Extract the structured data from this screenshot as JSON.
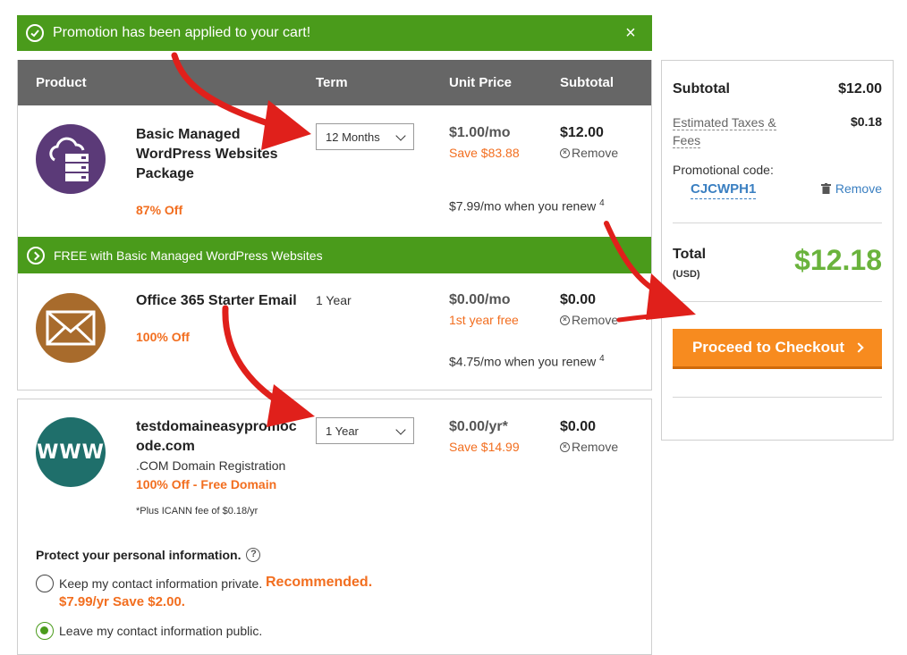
{
  "promo_banner": {
    "text": "Promotion has been applied to your cart!",
    "close": "×"
  },
  "cart_header": {
    "product": "Product",
    "term": "Term",
    "unit_price": "Unit Price",
    "subtotal": "Subtotal"
  },
  "items": [
    {
      "name": "Basic Managed WordPress Websites Package",
      "discount": "87% Off",
      "term": "12 Months",
      "price": "$1.00/mo",
      "save": "Save $83.88",
      "subtotal": "$12.00",
      "remove": "Remove",
      "renew": "$7.99/mo when you renew",
      "renew_note": "4",
      "icon": "cloud-server-icon",
      "color": "#5b3a78"
    },
    {
      "name": "Office 365 Starter Email",
      "discount": "100% Off",
      "term": "1 Year",
      "price": "$0.00/mo",
      "save": "1st year free",
      "subtotal": "$0.00",
      "remove": "Remove",
      "renew": "$4.75/mo when you renew",
      "renew_note": "4",
      "icon": "envelope-icon",
      "color": "#a86b2c"
    }
  ],
  "free_banner": "FREE with Basic Managed WordPress Websites",
  "domain": {
    "name_line1": "testdomaineasypromoc",
    "name_line2": "ode.com",
    "desc": ".COM Domain Registration",
    "discount": "100% Off - Free Domain",
    "icann": "*Plus ICANN fee of $0.18/yr",
    "term": "1 Year",
    "price": "$0.00/yr*",
    "save": "Save $14.99",
    "subtotal": "$0.00",
    "remove": "Remove",
    "icon_text": "WWW",
    "color": "#1f6f6b",
    "protect_title": "Protect your personal information.",
    "help": "?",
    "option_private": "Keep my contact information private.",
    "recommended": "Recommended.",
    "private_price": "$7.99/yr Save $2.00.",
    "option_public": "Leave my contact information public.",
    "selected": "public"
  },
  "summary": {
    "subtotal_label": "Subtotal",
    "subtotal_value": "$12.00",
    "tax_label": "Estimated Taxes & Fees",
    "tax_value": "$0.18",
    "promo_label": "Promotional code:",
    "promo_code": "CJCWPH1",
    "promo_remove": "Remove",
    "total_label": "Total",
    "currency": "(USD)",
    "total_value": "$12.18",
    "checkout_label": "Proceed to Checkout"
  },
  "colors": {
    "green": "#4a9b1b",
    "orange": "#f78b1f",
    "header_gray": "#666666",
    "link_blue": "#3a7fc1",
    "total_green": "#6ab33c",
    "annotation_red": "#e0201b"
  }
}
